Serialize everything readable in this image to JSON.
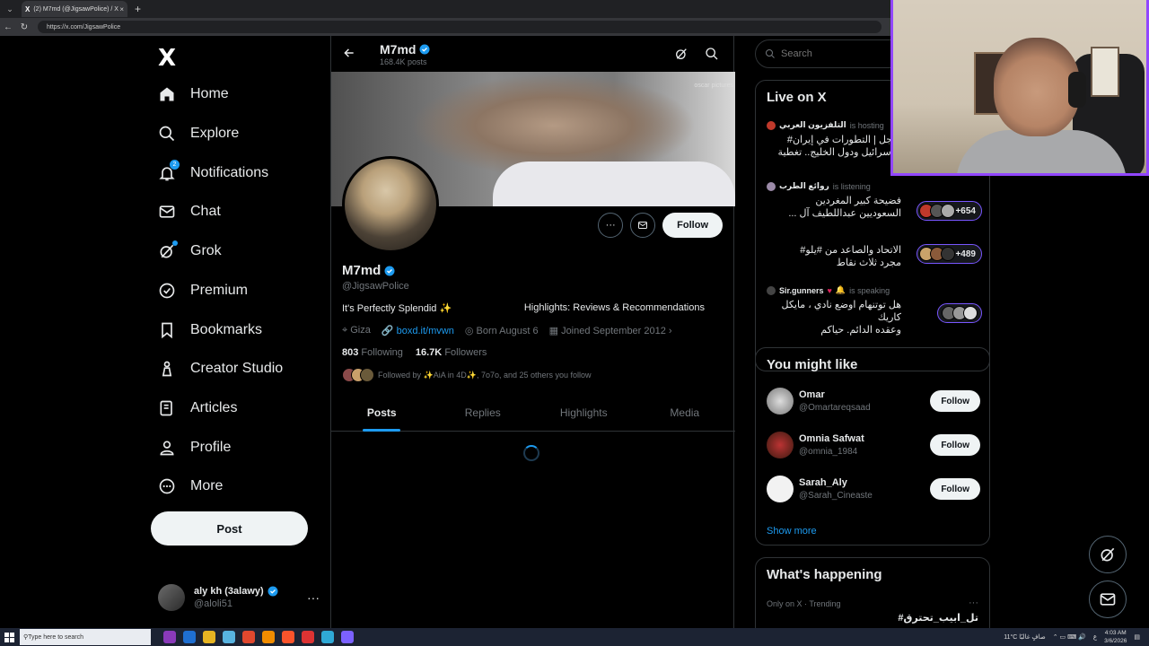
{
  "browser": {
    "tab_title": "(2) M7md (@JigsawPolice) / X",
    "tab_logo": "X",
    "tab_close": "×",
    "new_tab": "+",
    "url": "https://x.com/JigsawPolice"
  },
  "sidebar": {
    "logo": "X",
    "items": [
      {
        "label": "Home",
        "icon": "home-icon"
      },
      {
        "label": "Explore",
        "icon": "search-icon"
      },
      {
        "label": "Notifications",
        "icon": "bell-icon",
        "badge": "2"
      },
      {
        "label": "Chat",
        "icon": "mail-icon"
      },
      {
        "label": "Grok",
        "icon": "grok-icon"
      },
      {
        "label": "Premium",
        "icon": "premium-icon"
      },
      {
        "label": "Bookmarks",
        "icon": "bookmark-icon"
      },
      {
        "label": "Creator Studio",
        "icon": "creator-studio-icon"
      },
      {
        "label": "Articles",
        "icon": "articles-icon"
      },
      {
        "label": "Profile",
        "icon": "person-icon"
      },
      {
        "label": "More",
        "icon": "more-circle-icon"
      }
    ],
    "post_button": "Post",
    "account": {
      "name": "aly kh (3alawy)",
      "handle": "@aloli51",
      "more": "···"
    }
  },
  "profile": {
    "header_name": "M7md",
    "posts_count": "168.4K posts",
    "banner_watermark": "oscar pictures",
    "follow_button": "Follow",
    "more_button": "···",
    "name": "M7md",
    "handle": "@JigsawPolice",
    "bio": "It's Perfectly Splendid ✨",
    "highlights_text": "Highlights: Reviews & Recommendations",
    "location": "Giza",
    "link": "boxd.it/mvwn",
    "born": "Born August 6",
    "joined": "Joined September 2012",
    "following_count": "803",
    "following_label": "Following",
    "followers_count": "16.7K",
    "followers_label": "Followers",
    "followed_by": "Followed by ✨AiA in 4D✨, 7o7o, and 25 others you follow",
    "tabs": [
      "Posts",
      "Replies",
      "Highlights",
      "Media"
    ],
    "active_tab": "Posts"
  },
  "right": {
    "search_placeholder": "Search",
    "live_title": "Live on X",
    "live": [
      {
        "host": "التلفزيون العربي",
        "status": "is hosting",
        "title": "عاجل | التطورات في إيران#\nو إسرائيل ودول الخليج.. تغطية",
        "count": ""
      },
      {
        "host": "روائع الطرب",
        "status": "is listening",
        "title": "فضيحة كبير المغردين\nالسعوديين عبداللطيف آل ...",
        "count": "+654"
      },
      {
        "host": "",
        "status": "",
        "title": "الاتحاد والصاعد من #يلو#\nمجرد ثلاث نقاط",
        "count": "+489"
      },
      {
        "host": "Sir.gunners",
        "status": "is speaking",
        "title": "هل توتنهام اوضع نادي ، مايكل كاريك\nوعقده الدائم. حياكم",
        "count": ""
      }
    ],
    "suggest_title": "You might like",
    "suggestions": [
      {
        "name": "Omar",
        "handle": "@Omartareqsaad",
        "button": "Follow"
      },
      {
        "name": "Omnia Safwat",
        "handle": "@omnia_1984",
        "button": "Follow"
      },
      {
        "name": "Sarah_Aly",
        "handle": "@Sarah_Cineaste",
        "button": "Follow"
      }
    ],
    "show_more": "Show more",
    "happening_title": "What's happening",
    "trend_meta": "Only on X · Trending",
    "trend_more": "···",
    "trend_name": "#تل_ابيب_تحترق"
  },
  "taskbar": {
    "search_placeholder": "Type here to search",
    "weather": "11°C صافٍ غالبًا",
    "lang": "ع",
    "time": "4:03 AM",
    "date": "3/6/2026"
  },
  "colors": {
    "accent": "#1d9bf0",
    "live_border": "#7856ff",
    "cam_border": "#9146ff"
  }
}
